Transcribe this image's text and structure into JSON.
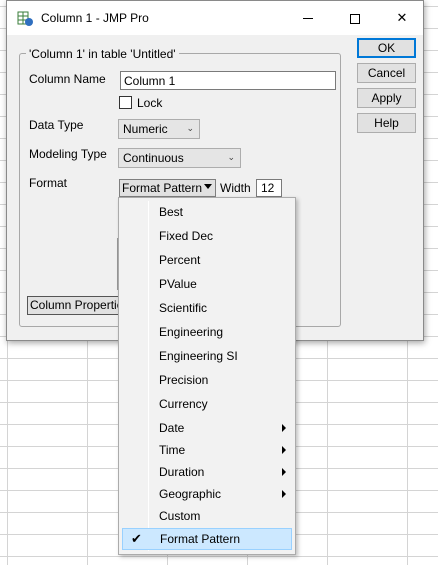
{
  "window": {
    "title": "Column 1 - JMP Pro"
  },
  "group": {
    "title": "'Column 1' in table 'Untitled'"
  },
  "form": {
    "column_name_label": "Column Name",
    "column_name_value": "Column 1",
    "lock_label": "Lock",
    "data_type_label": "Data Type",
    "data_type_value": "Numeric",
    "modeling_type_label": "Modeling Type",
    "modeling_type_value": "Continuous",
    "format_label": "Format",
    "format_value": "Format Pattern",
    "width_label": "Width",
    "width_value": "12",
    "column_properties_label": "Column Properties"
  },
  "buttons": {
    "ok": "OK",
    "cancel": "Cancel",
    "apply": "Apply",
    "help": "Help"
  },
  "menu": {
    "items": [
      {
        "label": "Best"
      },
      {
        "label": "Fixed Dec"
      },
      {
        "label": "Percent"
      },
      {
        "label": "PValue"
      },
      {
        "label": "Scientific"
      },
      {
        "label": "Engineering"
      },
      {
        "label": "Engineering SI"
      },
      {
        "label": "Precision"
      },
      {
        "label": "Currency"
      },
      {
        "label": "Date"
      },
      {
        "label": "Time"
      },
      {
        "label": "Duration"
      },
      {
        "label": "Geographic"
      },
      {
        "label": "Custom"
      },
      {
        "label": "Format Pattern"
      }
    ],
    "checked_item": "Format Pattern"
  },
  "colors": {
    "selection": "#cce8ff",
    "selection_border": "#99d1ff",
    "default_button_border": "#0078d7"
  }
}
